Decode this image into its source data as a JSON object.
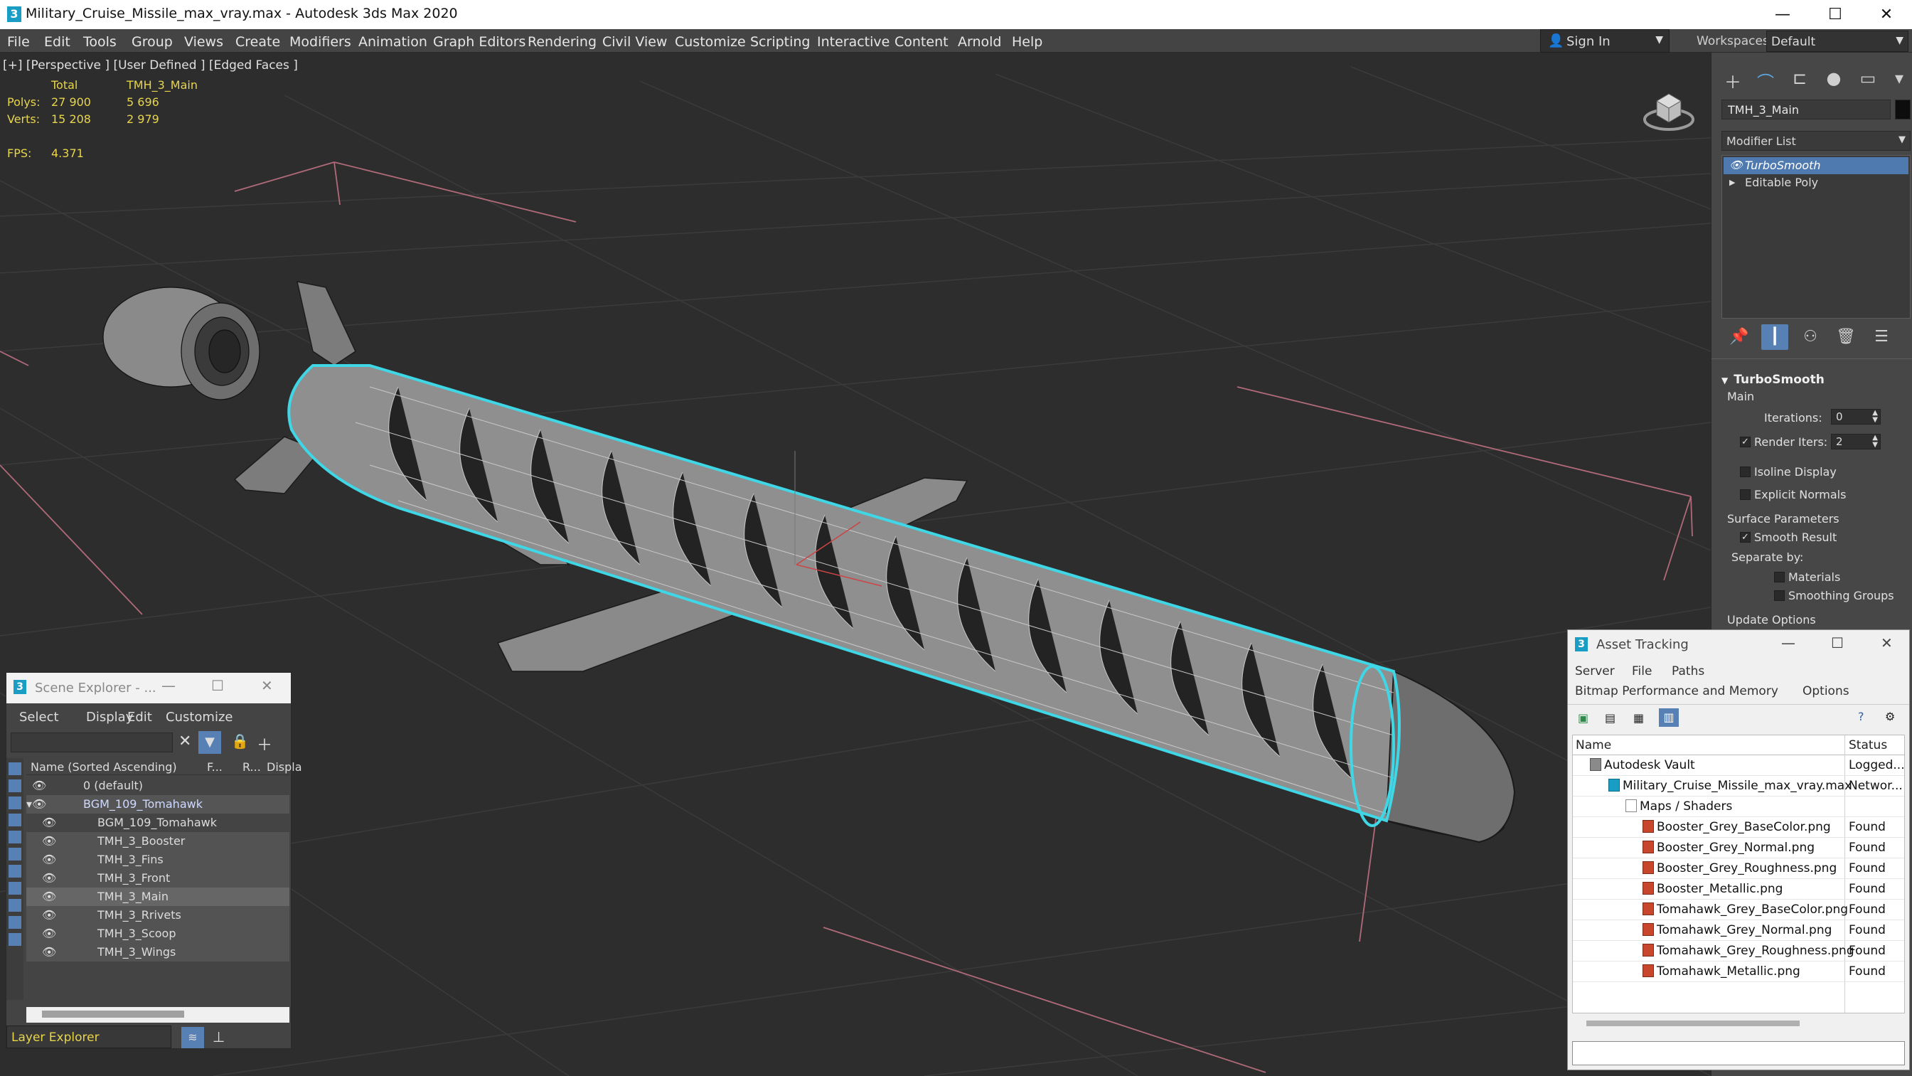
{
  "window": {
    "title": "Military_Cruise_Missile_max_vray.max - Autodesk 3ds Max 2020",
    "minimize": "—",
    "maximize": "☐",
    "close": "✕"
  },
  "menu": [
    "File",
    "Edit",
    "Tools",
    "Group",
    "Views",
    "Create",
    "Modifiers",
    "Animation",
    "Graph Editors",
    "Rendering",
    "Civil View",
    "Customize",
    "Scripting",
    "Interactive",
    "Content",
    "Arnold",
    "Help"
  ],
  "signin": {
    "label": "Sign In"
  },
  "workspaces": {
    "label": "Workspaces:",
    "value": "Default"
  },
  "viewport": {
    "label": "[+] [Perspective ] [User Defined ] [Edged Faces ]",
    "stats": {
      "col_total": "Total",
      "col_object": "TMH_3_Main",
      "polys_label": "Polys:",
      "polys_total": "27 900",
      "polys_obj": "5 696",
      "verts_label": "Verts:",
      "verts_total": "15 208",
      "verts_obj": "2 979",
      "fps_label": "FPS:",
      "fps_value": "4.371"
    }
  },
  "command_panel": {
    "object_name": "TMH_3_Main",
    "modifier_list": "Modifier List",
    "stack": [
      "TurboSmooth",
      "Editable Poly"
    ],
    "turbosmooth": {
      "title": "TurboSmooth",
      "main": "Main",
      "iterations_label": "Iterations:",
      "iterations_value": "0",
      "render_iters_label": "Render Iters:",
      "render_iters_value": "2",
      "isoline": "Isoline Display",
      "explicit": "Explicit Normals",
      "surface": "Surface Parameters",
      "smooth_result": "Smooth Result",
      "separate_by": "Separate by:",
      "materials": "Materials",
      "smoothing_groups": "Smoothing Groups",
      "update_options": "Update Options"
    }
  },
  "scene_explorer": {
    "title": "Scene Explorer - ...",
    "menu": [
      "Select",
      "Display",
      "Edit",
      "Customize"
    ],
    "columns": {
      "name": "Name (Sorted Ascending)",
      "frozen": "F...",
      "render": "R...",
      "display": "Displa"
    },
    "rows": [
      {
        "name": "0 (default)"
      },
      {
        "name": "BGM_109_Tomahawk"
      },
      {
        "name": "BGM_109_Tomahawk"
      },
      {
        "name": "TMH_3_Booster"
      },
      {
        "name": "TMH_3_Fins"
      },
      {
        "name": "TMH_3_Front"
      },
      {
        "name": "TMH_3_Main"
      },
      {
        "name": "TMH_3_Rrivets"
      },
      {
        "name": "TMH_3_Scoop"
      },
      {
        "name": "TMH_3_Wings"
      }
    ],
    "footer": "Layer Explorer"
  },
  "asset_tracking": {
    "title": "Asset Tracking",
    "menu1": [
      "Server",
      "File",
      "Paths"
    ],
    "menu2": [
      "Bitmap Performance and Memory",
      "Options"
    ],
    "columns": {
      "name": "Name",
      "status": "Status"
    },
    "rows": [
      {
        "name": "Autodesk Vault",
        "status": "Logged..."
      },
      {
        "name": "Military_Cruise_Missile_max_vray.max",
        "status": "Networ..."
      },
      {
        "name": "Maps / Shaders",
        "status": ""
      },
      {
        "name": "Booster_Grey_BaseColor.png",
        "status": "Found"
      },
      {
        "name": "Booster_Grey_Normal.png",
        "status": "Found"
      },
      {
        "name": "Booster_Grey_Roughness.png",
        "status": "Found"
      },
      {
        "name": "Booster_Metallic.png",
        "status": "Found"
      },
      {
        "name": "Tomahawk_Grey_BaseColor.png",
        "status": "Found"
      },
      {
        "name": "Tomahawk_Grey_Normal.png",
        "status": "Found"
      },
      {
        "name": "Tomahawk_Grey_Roughness.png",
        "status": "Found"
      },
      {
        "name": "Tomahawk_Metallic.png",
        "status": "Found"
      }
    ]
  },
  "icons": [
    "app-icon",
    "user-icon",
    "viewcube-icon",
    "create-icon",
    "modify-icon",
    "hierarchy-icon",
    "motion-icon",
    "display-icon",
    "utilities-icon",
    "pin-icon",
    "show-end-result-icon",
    "make-unique-icon",
    "remove-modifier-icon",
    "configure-icon",
    "eye-icon",
    "clear-icon",
    "filter-icon",
    "lock-icon",
    "add-icon",
    "png-file-icon",
    "vault-icon",
    "max-file-icon",
    "folder-icon"
  ],
  "colors": {
    "selection_outline": "#3fd6e6",
    "stat_text": "#e8d54a",
    "stack_selected": "#4f7ab0",
    "viewport_bg": "#2d2d2d"
  }
}
